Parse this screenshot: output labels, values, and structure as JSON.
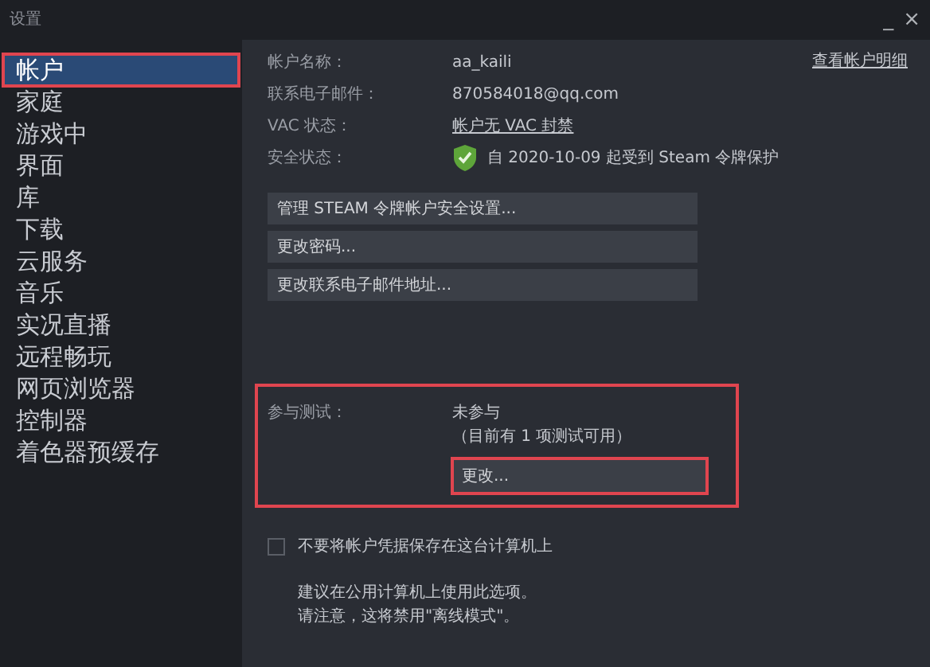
{
  "window": {
    "title": "设置",
    "controls": [
      "_",
      "×"
    ]
  },
  "sidebar": {
    "items": [
      {
        "label": "帐户",
        "selected": true,
        "highlighted": true
      },
      {
        "label": "家庭",
        "selected": false,
        "highlighted": false
      },
      {
        "label": "游戏中",
        "selected": false,
        "highlighted": false
      },
      {
        "label": "界面",
        "selected": false,
        "highlighted": false
      },
      {
        "label": "库",
        "selected": false,
        "highlighted": false
      },
      {
        "label": "下载",
        "selected": false,
        "highlighted": false
      },
      {
        "label": "云服务",
        "selected": false,
        "highlighted": false
      },
      {
        "label": "音乐",
        "selected": false,
        "highlighted": false
      },
      {
        "label": "实况直播",
        "selected": false,
        "highlighted": false
      },
      {
        "label": "远程畅玩",
        "selected": false,
        "highlighted": false
      },
      {
        "label": "网页浏览器",
        "selected": false,
        "highlighted": false
      },
      {
        "label": "控制器",
        "selected": false,
        "highlighted": false
      },
      {
        "label": "着色器预缓存",
        "selected": false,
        "highlighted": false
      }
    ]
  },
  "account": {
    "view_details_link": "查看帐户明细",
    "rows": [
      {
        "label": "帐户名称：",
        "value": "aa_kaili",
        "kind": "text"
      },
      {
        "label": "联系电子邮件：",
        "value": "870584018@qq.com",
        "kind": "text"
      },
      {
        "label": "VAC 状态：",
        "value": "帐户无 VAC 封禁",
        "kind": "link"
      },
      {
        "label": "安全状态：",
        "value": "自 2020-10-09 起受到 Steam 令牌保护",
        "kind": "shield"
      }
    ],
    "buttons": [
      "管理 STEAM 令牌帐户安全设置...",
      "更改密码...",
      "更改联系电子邮件地址..."
    ]
  },
  "beta": {
    "label": "参与测试：",
    "status": "未参与",
    "note": "（目前有 1 项测试可用）",
    "highlighted": true,
    "change_button": {
      "label": "更改...",
      "highlighted": true
    }
  },
  "remember": {
    "label": "不要将帐户凭据保存在这台计算机上",
    "checked": false,
    "hint": [
      "建议在公用计算机上使用此选项。",
      "请注意，这将禁用\"离线模式\"。"
    ]
  }
}
